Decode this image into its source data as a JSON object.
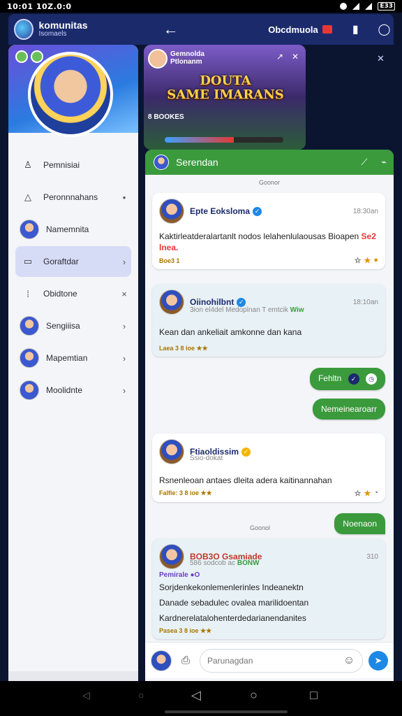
{
  "status_bar": {
    "time": "10:01 10Z.0:0",
    "battery": "E33"
  },
  "app_bar": {
    "title": "komunitas",
    "subtitle": "Isomaels",
    "chat_name": "Obcdmuola",
    "back_glyph": "←"
  },
  "drawer": {
    "items": [
      {
        "label": "Pemnisiai",
        "icon": "person-icon",
        "tail": ""
      },
      {
        "label": "Peronnnahans",
        "icon": "triangle-icon",
        "tail": "•"
      },
      {
        "label": "Namemnita",
        "icon": "avatar",
        "tail": ""
      },
      {
        "label": "Goraftdar",
        "icon": "folder-icon",
        "tail": "›",
        "active": true
      },
      {
        "label": "Obidtone",
        "icon": "grid-icon",
        "tail": "×"
      },
      {
        "label": "Sengiiisa",
        "icon": "avatar",
        "tail": "›"
      },
      {
        "label": "Mapemtian",
        "icon": "avatar",
        "tail": "›"
      },
      {
        "label": "Moolidnte",
        "icon": "avatar",
        "tail": "›"
      }
    ]
  },
  "banner": {
    "name": "Gemnolda\nPtlonanm",
    "title": "DOUTA\nSAME IMARANS",
    "sub": "8 BOOKES",
    "progress": 0.58
  },
  "chat": {
    "header": "Serendan",
    "date_top": "Goonor",
    "messages": [
      {
        "name": "Epte Eoksloma",
        "badge": "✓",
        "time": "18:30an",
        "sub": "",
        "text": "Kaktirleatderalartanlt nodos lelahenlulaousas Bioapen",
        "highlight": "Se2 lnea.",
        "foot": "Boe3 1"
      },
      {
        "name": "Oiinohilbnt",
        "badge": "✓",
        "time": "18:10an",
        "sub": "3ion el4del Medoplnan T emtcik",
        "sub_green": "Wiw",
        "text": "Kean dan ankeliait amkonne dan kana",
        "foot": "Laea 3 8 ioe ★★"
      },
      {
        "name": "Ftiaoldissim",
        "badge": "✓",
        "time": "",
        "sub": "Ssio-dokat",
        "text": "Rsnenleoan antaes dleita adera kaitinannahan",
        "foot": "Falfie: 3 8 ioe ★★"
      },
      {
        "name": "BOB3O Gsamiade",
        "badge": "",
        "time": "310",
        "sub": "586 sodcob ac",
        "sub_green": "BONW",
        "tag": "Pemirale ●O",
        "text": "Sorjdenkekonlemenlerinles Indeanektn",
        "text2": "Danade sebadulec ovalea marilidoentan",
        "text3": "Kardnerelatalohenterdedarianendanites",
        "foot": "Pasea 3 8 ioe ★★"
      }
    ],
    "bubbles": {
      "b1": "Fehltn",
      "b2": "Nemeinearoarr",
      "b3": "Noenaon"
    },
    "date_mid": "Goonol",
    "input_placeholder": "Parunagdan"
  },
  "colors": {
    "appbar": "#1b2a6b",
    "accent_green": "#3a9a3c",
    "send_blue": "#1e88e5"
  }
}
